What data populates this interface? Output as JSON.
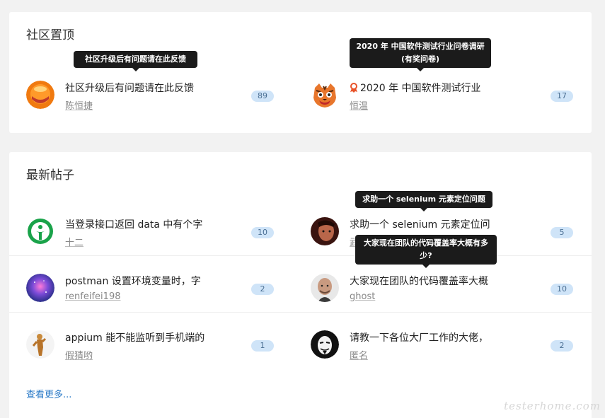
{
  "pinned": {
    "title": "社区置顶",
    "topics": [
      {
        "title": "社区升级后有问题请在此反馈",
        "author": "陈恒捷",
        "count": "89",
        "tooltip": "社区升级后有问题请在此反馈",
        "avatar_icon": "orange-face-avatar"
      },
      {
        "title": "2020 年 中国软件测试行业",
        "author": "恒温",
        "count": "17",
        "tooltip": "2020 年 中国软件测试行业问卷调研 (有奖问卷)",
        "avatar_icon": "tiger-avatar",
        "badge_icon": "award-medal-icon"
      }
    ]
  },
  "latest": {
    "title": "最新帖子",
    "topics": [
      {
        "title": "当登录接口返回 data 中有个字",
        "author": "十二",
        "count": "10",
        "avatar_icon": "green-logo-avatar"
      },
      {
        "title": "求助一个 selenium 元素定位问",
        "author": "武魂",
        "count": "5",
        "tooltip": "求助一个 selenium 元素定位问题",
        "avatar_icon": "person-photo-avatar"
      },
      {
        "title": "postman 设置环境变量时，字",
        "author": "renfeifei198",
        "count": "2",
        "avatar_icon": "nebula-avatar"
      },
      {
        "title": "大家现在团队的代码覆盖率大概",
        "author": "ghost",
        "count": "10",
        "tooltip": "大家现在团队的代码覆盖率大概有多少?",
        "avatar_icon": "bald-man-avatar"
      },
      {
        "title": "appium 能不能监听到手机端的",
        "author": "假猜哟",
        "count": "1",
        "avatar_icon": "figure-avatar"
      },
      {
        "title": "请教一下各位大厂工作的大佬，",
        "author": "匿名",
        "count": "2",
        "avatar_icon": "mask-avatar"
      }
    ],
    "more_label": "查看更多..."
  },
  "watermark": "testerhome.com",
  "colors": {
    "badge_bg": "#cfe4f8",
    "badge_text": "#4a6e92",
    "link": "#2a7ac7",
    "tooltip_bg": "#1b1b1b"
  }
}
